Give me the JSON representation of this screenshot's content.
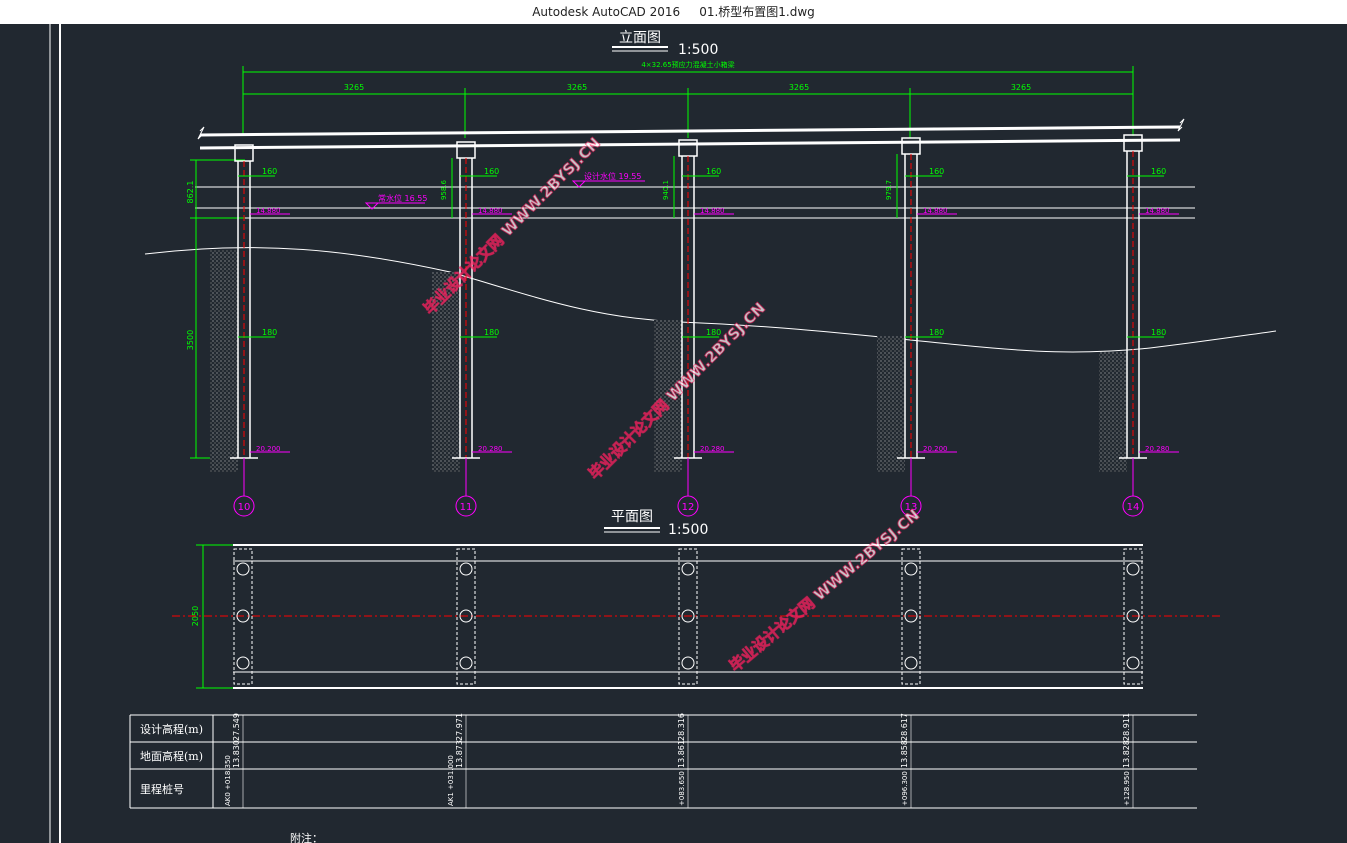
{
  "window": {
    "app_name": "Autodesk AutoCAD 2016",
    "file_name": "01.桥型布置图1.dwg"
  },
  "elevation_view": {
    "title": "立面图",
    "scale": "1:500",
    "total_span_label": "4×32.65预应力混凝土小箱梁",
    "span_labels": [
      "3265",
      "3265",
      "3265",
      "3265"
    ],
    "pier_ids": [
      "10",
      "11",
      "12",
      "13",
      "14"
    ],
    "pier_cap_width": "160",
    "pile_diameter": "180",
    "pier_tops": [
      "14.880",
      "14.880",
      "14.880",
      "14.880",
      "14.880"
    ],
    "pile_bottoms": [
      "20.200",
      "20.280",
      "20.280",
      "20.200",
      "20.280"
    ],
    "pier_heights": [
      "862.1",
      "958.6",
      "940.1",
      "979.7"
    ],
    "pile_length": "3500",
    "water_levels": [
      "常水位 16.55",
      "设计水位 19.55"
    ]
  },
  "plan_view": {
    "title": "平面图",
    "scale": "1:500",
    "width_label": "2050"
  },
  "profile_table": {
    "rows": [
      {
        "label": "设计高程(m)",
        "values": [
          "27.549",
          "27.971",
          "28.316",
          "28.617",
          "28.911"
        ]
      },
      {
        "label": "地面高程(m)",
        "values": [
          "13.830",
          "13.873",
          "13.861",
          "13.858",
          "13.828"
        ]
      },
      {
        "label": "里程桩号",
        "values": [
          "AK0\n+018.350",
          "AK1\n+031.000",
          "+083.650",
          "+096.300",
          "+128.950"
        ]
      }
    ]
  },
  "notes_label": "附注：",
  "watermark": "毕业设计论文网 WWW.2BYSJ.CN"
}
